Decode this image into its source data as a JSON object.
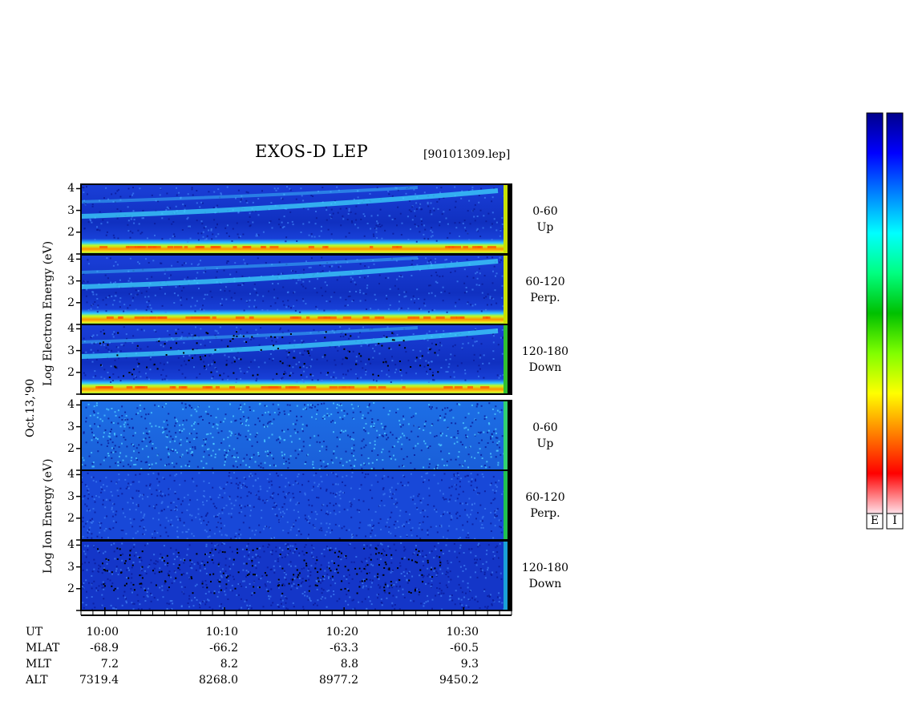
{
  "header": {
    "title": "EXOS-D LEP",
    "filename": "[90101309.lep]"
  },
  "side_labels": {
    "electron": "Log   Electron   Energy (eV)",
    "ion": "Log   Ion   Energy (eV)",
    "date": "Oct.13,'90"
  },
  "panels": [
    {
      "species": "electron",
      "pitch": "0-60",
      "dir": "Up"
    },
    {
      "species": "electron",
      "pitch": "60-120",
      "dir": "Perp."
    },
    {
      "species": "electron",
      "pitch": "120-180",
      "dir": "Down"
    },
    {
      "species": "ion",
      "pitch": "0-60",
      "dir": "Up"
    },
    {
      "species": "ion",
      "pitch": "60-120",
      "dir": "Perp."
    },
    {
      "species": "ion",
      "pitch": "120-180",
      "dir": "Down"
    }
  ],
  "colorbar": {
    "labels": [
      "E",
      "I"
    ],
    "colors": [
      "#00008b",
      "#0000ff",
      "#0080ff",
      "#00ffff",
      "#00ff80",
      "#00c000",
      "#80ff00",
      "#ffff00",
      "#ff8000",
      "#ff0000",
      "#ffe0e8"
    ]
  },
  "ephemeris": {
    "row_labels": [
      "UT",
      "MLAT",
      "MLT",
      "ALT"
    ],
    "columns": [
      {
        "UT": "10:00",
        "MLAT": "-68.9",
        "MLT": "7.2",
        "ALT": "7319.4"
      },
      {
        "UT": "10:10",
        "MLAT": "-66.2",
        "MLT": "8.2",
        "ALT": "8268.0"
      },
      {
        "UT": "10:20",
        "MLAT": "-63.3",
        "MLT": "8.8",
        "ALT": "8977.2"
      },
      {
        "UT": "10:30",
        "MLAT": "-60.5",
        "MLT": "9.3",
        "ALT": "9450.2"
      }
    ]
  },
  "chart_data": {
    "type": "heatmap",
    "title": "EXOS-D LEP",
    "x": {
      "tick_labels": [
        "10:00",
        "10:10",
        "10:20",
        "10:30"
      ],
      "tick_minutes": [
        0,
        10,
        20,
        30
      ],
      "range_minutes": [
        -2,
        34
      ]
    },
    "y": {
      "label": "Log Energy (eV)",
      "tick_labels": [
        "2",
        "3",
        "4"
      ],
      "ticks": [
        2,
        3,
        4
      ],
      "range": [
        1.0,
        4.2
      ]
    },
    "panels": [
      {
        "name": "Electron 0-60 Up"
      },
      {
        "name": "Electron 60-120 Perp."
      },
      {
        "name": "Electron 120-180 Down"
      },
      {
        "name": "Ion 0-60 Up"
      },
      {
        "name": "Ion 60-120 Perp."
      },
      {
        "name": "Ion 120-180 Down"
      }
    ]
  }
}
